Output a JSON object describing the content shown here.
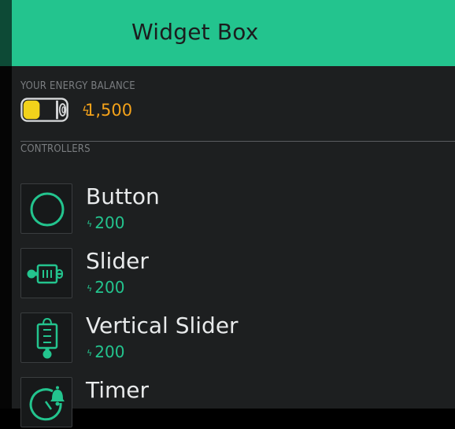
{
  "header": {
    "title": "Widget Box"
  },
  "energy": {
    "label": "YOUR ENERGY BALANCE",
    "balance": "1,500",
    "bolt": "ϟ",
    "battery_level": 0.4
  },
  "controllers": {
    "label": "CONTROLLERS",
    "items": [
      {
        "name": "Button",
        "price": "200",
        "bolt": "ϟ",
        "icon": "circle-icon"
      },
      {
        "name": "Slider",
        "price": "200",
        "bolt": "ϟ",
        "icon": "slider-icon"
      },
      {
        "name": "Vertical Slider",
        "price": "200",
        "bolt": "ϟ",
        "icon": "vertical-slider-icon"
      },
      {
        "name": "Timer",
        "price": "",
        "bolt": "",
        "icon": "timer-icon"
      }
    ]
  },
  "colors": {
    "accent": "#23c48e",
    "energy": "#f4a21a",
    "background": "#1d1f20"
  }
}
